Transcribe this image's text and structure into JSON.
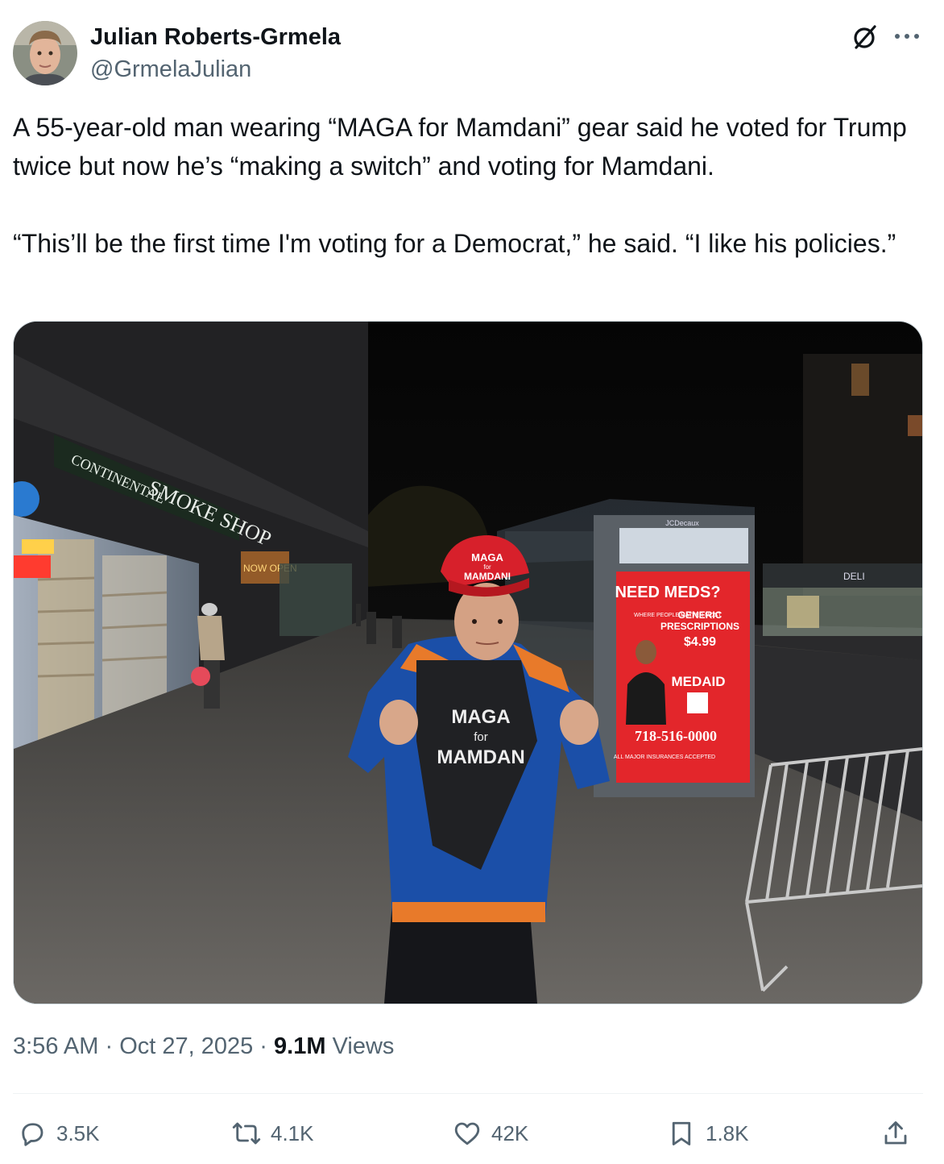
{
  "author": {
    "name": "Julian Roberts-Grmela",
    "handle": "@GrmelaJulian"
  },
  "tweet": {
    "paragraphs": [
      "A 55-year-old man wearing “MAGA for Mamdani” gear said he voted for Trump twice but now he’s “making a switch” and voting for Mamdani.",
      "“This’ll be the first time I'm voting for a Democrat,” he said. “I like his policies.”"
    ]
  },
  "photo": {
    "store_sign_1": "CONTINENTAL",
    "store_sign_2": "SMOKE SHOP",
    "store_open_sign": "NOW OPEN",
    "hat_line1": "MAGA",
    "hat_line2": "for",
    "hat_line3": "MAMDANI",
    "shirt_line1": "MAGA",
    "shirt_line2": "for",
    "shirt_line3": "MAMDAN",
    "ad_brand": "JCDecaux",
    "ad_headline": "NEED MEDS?",
    "ad_sub1": "GENERIC",
    "ad_sub2": "PRESCRIPTIONS",
    "ad_tag": "WHERE PEOPLE MATTER MOST",
    "ad_price": "$4.99",
    "ad_logo": "MEDAID",
    "ad_phone": "718-516-0000",
    "ad_insurance": "ALL MAJOR INSURANCES ACCEPTED",
    "deli_sign": "DELI"
  },
  "meta": {
    "time": "3:56 AM",
    "sep1": " · ",
    "date": "Oct 27, 2025",
    "sep2": " · ",
    "views_count": "9.1M",
    "views_label": " Views"
  },
  "actions": {
    "replies": "3.5K",
    "reposts": "4.1K",
    "likes": "42K",
    "bookmarks": "1.8K"
  },
  "icons": [
    "grok-icon",
    "more-icon",
    "reply-icon",
    "repost-icon",
    "like-icon",
    "bookmark-icon",
    "share-icon"
  ],
  "colors": {
    "text": "#0f1419",
    "secondary": "#536471",
    "divider": "#eff3f4",
    "hat_red": "#d7202b",
    "ad_red": "#e3262b"
  }
}
